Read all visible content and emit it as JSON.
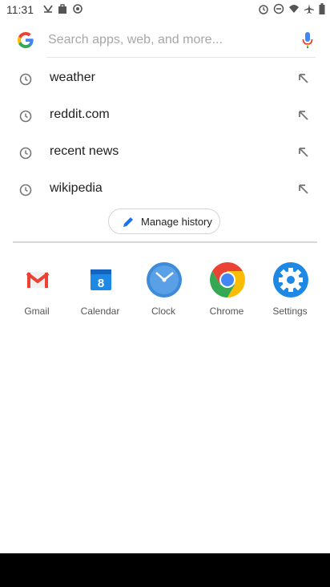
{
  "status_bar": {
    "time": "11:31",
    "left_icons": [
      "missed-call-icon",
      "x-notification-icon",
      "bag-icon",
      "sync-icon"
    ],
    "right_icons": [
      "alarm-icon",
      "dnd-icon",
      "wifi-icon",
      "airplane-icon",
      "battery-icon"
    ]
  },
  "search": {
    "placeholder": "Search apps, web, and more...",
    "value": ""
  },
  "history": [
    {
      "label": "weather"
    },
    {
      "label": "reddit.com"
    },
    {
      "label": "recent news"
    },
    {
      "label": "wikipedia"
    }
  ],
  "manage_history_label": "Manage history",
  "apps": [
    {
      "name": "Gmail",
      "icon": "gmail-icon"
    },
    {
      "name": "Calendar",
      "icon": "calendar-icon",
      "badge": "8"
    },
    {
      "name": "Clock",
      "icon": "clock-app-icon"
    },
    {
      "name": "Chrome",
      "icon": "chrome-icon"
    },
    {
      "name": "Settings",
      "icon": "settings-icon"
    }
  ],
  "colors": {
    "google_blue": "#4285F4",
    "google_red": "#EA4335",
    "google_yellow": "#FBBC05",
    "google_green": "#34A853",
    "settings_blue": "#1E88E5"
  }
}
